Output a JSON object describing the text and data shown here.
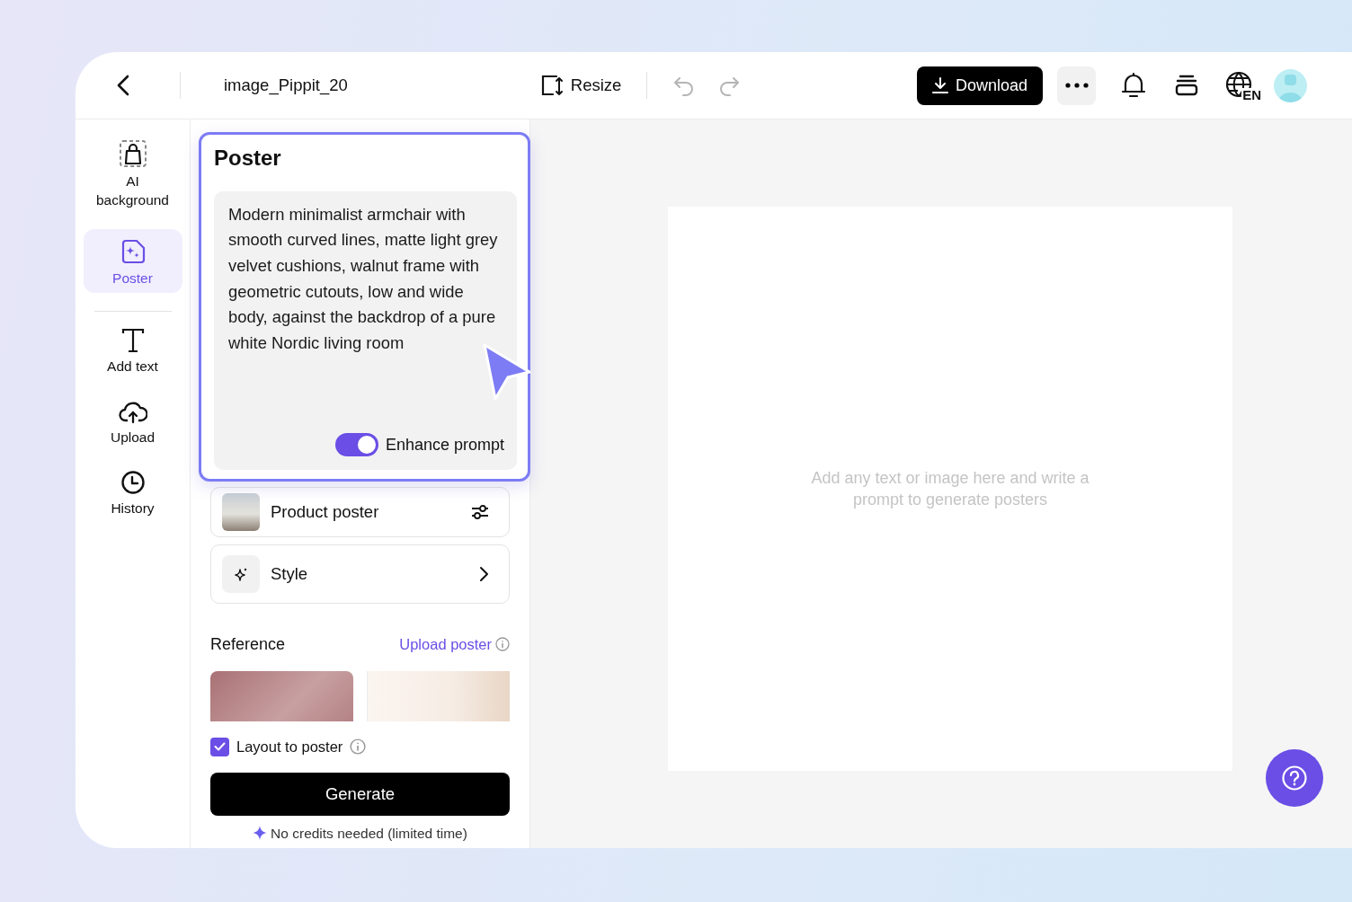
{
  "header": {
    "title": "image_Pippit_20",
    "resize_label": "Resize",
    "download_label": "Download",
    "language": "EN"
  },
  "sidebar": {
    "groups": [
      [
        {
          "kind": "background",
          "label": "AI background",
          "selected": false
        },
        {
          "kind": "poster",
          "label": "Poster",
          "selected": true
        }
      ],
      [
        {
          "kind": "text",
          "label": "Add text",
          "selected": false
        },
        {
          "kind": "upload",
          "label": "Upload",
          "selected": false
        },
        {
          "kind": "history",
          "label": "History",
          "selected": false
        }
      ]
    ]
  },
  "poster_panel": {
    "title": "Poster",
    "prompt": "Modern minimalist armchair with smooth curved lines, matte light grey velvet cushions, walnut frame with geometric cutouts, low and wide body, against the backdrop of a pure white Nordic living room",
    "enhance_prompt": {
      "label": "Enhance prompt",
      "on": true
    }
  },
  "options": [
    {
      "kind": "product",
      "label": "Product poster"
    },
    {
      "kind": "style",
      "label": "Style"
    }
  ],
  "reference": {
    "title": "Reference",
    "upload_link": "Upload poster"
  },
  "layout_to_poster": {
    "label": "Layout to poster",
    "checked": true
  },
  "generate_button": "Generate",
  "credits_note": "No credits needed (limited time)",
  "canvas": {
    "hint": "Add any text or image here and write a prompt to generate posters"
  }
}
